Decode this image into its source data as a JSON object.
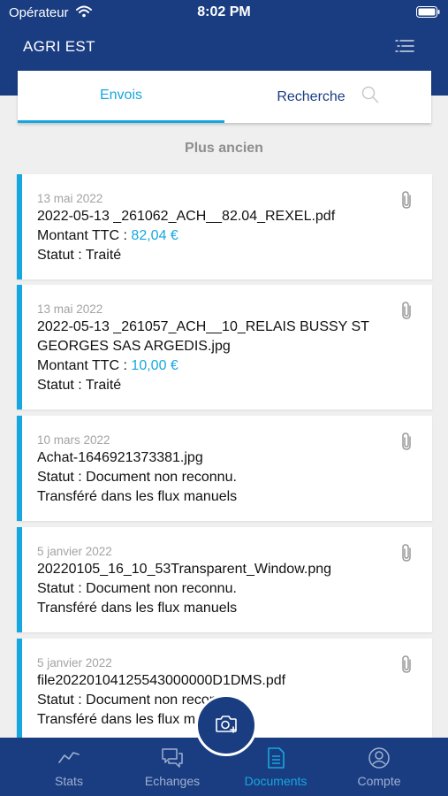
{
  "status_bar": {
    "carrier": "Opérateur",
    "time": "8:02 PM"
  },
  "header": {
    "title": "AGRI EST"
  },
  "tabs": {
    "envois": "Envois",
    "recherche": "Recherche"
  },
  "section_title": "Plus ancien",
  "documents": [
    {
      "date": "13 mai 2022",
      "filename": "2022-05-13 _261062_ACH__82.04_REXEL.pdf",
      "amount_label": "Montant TTC :",
      "amount": "82,04 €",
      "status": "Statut : Traité"
    },
    {
      "date": "13 mai 2022",
      "filename": "2022-05-13 _261057_ACH__10_RELAIS BUSSY ST GEORGES SAS ARGEDIS.jpg",
      "amount_label": "Montant TTC :",
      "amount": "10,00 €",
      "status": "Statut : Traité"
    },
    {
      "date": "10 mars 2022",
      "filename": "Achat-1646921373381.jpg",
      "status": "Statut : Document non reconnu.",
      "note": "Transféré dans les flux manuels"
    },
    {
      "date": "5 janvier 2022",
      "filename": "20220105_16_10_53Transparent_Window.png",
      "status": "Statut : Document non reconnu.",
      "note": "Transféré dans les flux manuels"
    },
    {
      "date": "5 janvier 2022",
      "filename": "file20220104125543000000D1DMS.pdf",
      "status": "Statut : Document non reconnu.",
      "note": "Transféré dans les flux manuels"
    }
  ],
  "bottom_nav": {
    "stats": "Stats",
    "echanges": "Echanges",
    "documents": "Documents",
    "compte": "Compte",
    "active": "documents"
  },
  "colors": {
    "primary": "#1a3d82",
    "accent": "#16a7e0",
    "background": "#efefef"
  },
  "icons": [
    "wifi-icon",
    "battery-icon",
    "menu-icon",
    "search-icon",
    "paperclip-icon",
    "camera-icon",
    "stats-icon",
    "chat-icon",
    "document-icon",
    "account-icon"
  ]
}
